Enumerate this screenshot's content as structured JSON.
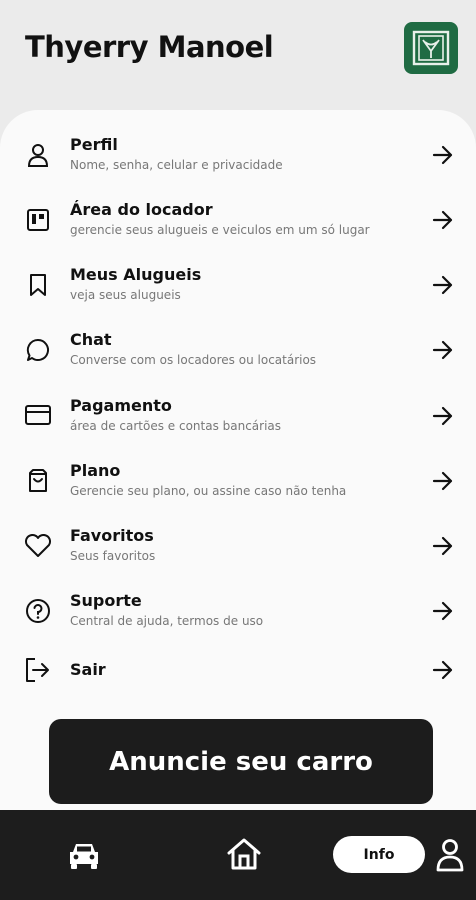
{
  "header": {
    "user_name": "Thyerry Manoel",
    "logo_icon": "brand-logo-icon",
    "brand_color": "#1f6b43"
  },
  "menu": [
    {
      "icon": "user-icon",
      "title": "Perfil",
      "subtitle": "Nome, senha, celular e privacidade"
    },
    {
      "icon": "dashboard-icon",
      "title": "Área do locador",
      "subtitle": "gerencie seus alugueis e veiculos em um só lugar"
    },
    {
      "icon": "bookmark-icon",
      "title": "Meus Alugueis",
      "subtitle": "veja seus alugueis"
    },
    {
      "icon": "chat-icon",
      "title": "Chat",
      "subtitle": "Converse com os locadores ou locatários"
    },
    {
      "icon": "credit-card-icon",
      "title": "Pagamento",
      "subtitle": "área de cartões e contas bancárias"
    },
    {
      "icon": "shopping-bag-icon",
      "title": "Plano",
      "subtitle": "Gerencie seu plano, ou assine caso não tenha"
    },
    {
      "icon": "heart-icon",
      "title": "Favoritos",
      "subtitle": "Seus favoritos"
    },
    {
      "icon": "help-circle-icon",
      "title": "Suporte",
      "subtitle": "Central de ajuda, termos de uso"
    },
    {
      "icon": "logout-icon",
      "title": "Sair",
      "subtitle": ""
    }
  ],
  "cta": {
    "label": "Anuncie seu carro"
  },
  "bottom_nav": {
    "car_icon": "car-icon",
    "home_icon": "home-icon",
    "active_label": "Info",
    "profile_icon": "user-icon"
  }
}
